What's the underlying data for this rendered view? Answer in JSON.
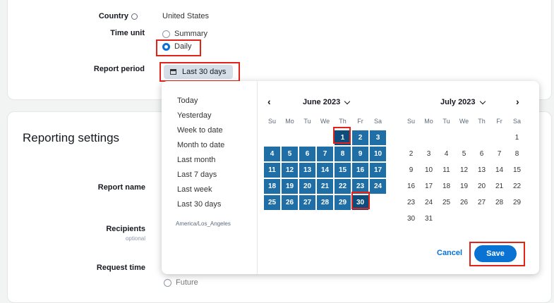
{
  "form": {
    "country_label": "Country",
    "country_value": "United States",
    "time_unit_label": "Time unit",
    "time_unit_options": [
      "Summary",
      "Daily"
    ],
    "time_unit_selected": "Daily",
    "report_period_label": "Report period",
    "report_period_value": "Last 30 days",
    "reporting_settings_heading": "Reporting settings",
    "report_name_label": "Report name",
    "recipients_label": "Recipients",
    "recipients_hint": "optional",
    "request_time_label": "Request time",
    "request_time_option": "Future"
  },
  "datepicker": {
    "ranges": [
      "Today",
      "Yesterday",
      "Week to date",
      "Month to date",
      "Last month",
      "Last 7 days",
      "Last week",
      "Last 30 days"
    ],
    "timezone": "America/Los_Angeles",
    "weekdays": [
      "Su",
      "Mo",
      "Tu",
      "We",
      "Th",
      "Fr",
      "Sa"
    ],
    "left_month": "June 2023",
    "right_month": "July 2023",
    "prev_icon": "chevron-left-icon",
    "next_icon": "chevron-right-icon",
    "cancel_label": "Cancel",
    "save_label": "Save"
  },
  "colors": {
    "accent": "#0972d3",
    "selected_day": "#1f6ea6",
    "range_edge": "#0d4d7e",
    "highlight": "#e2231a"
  }
}
